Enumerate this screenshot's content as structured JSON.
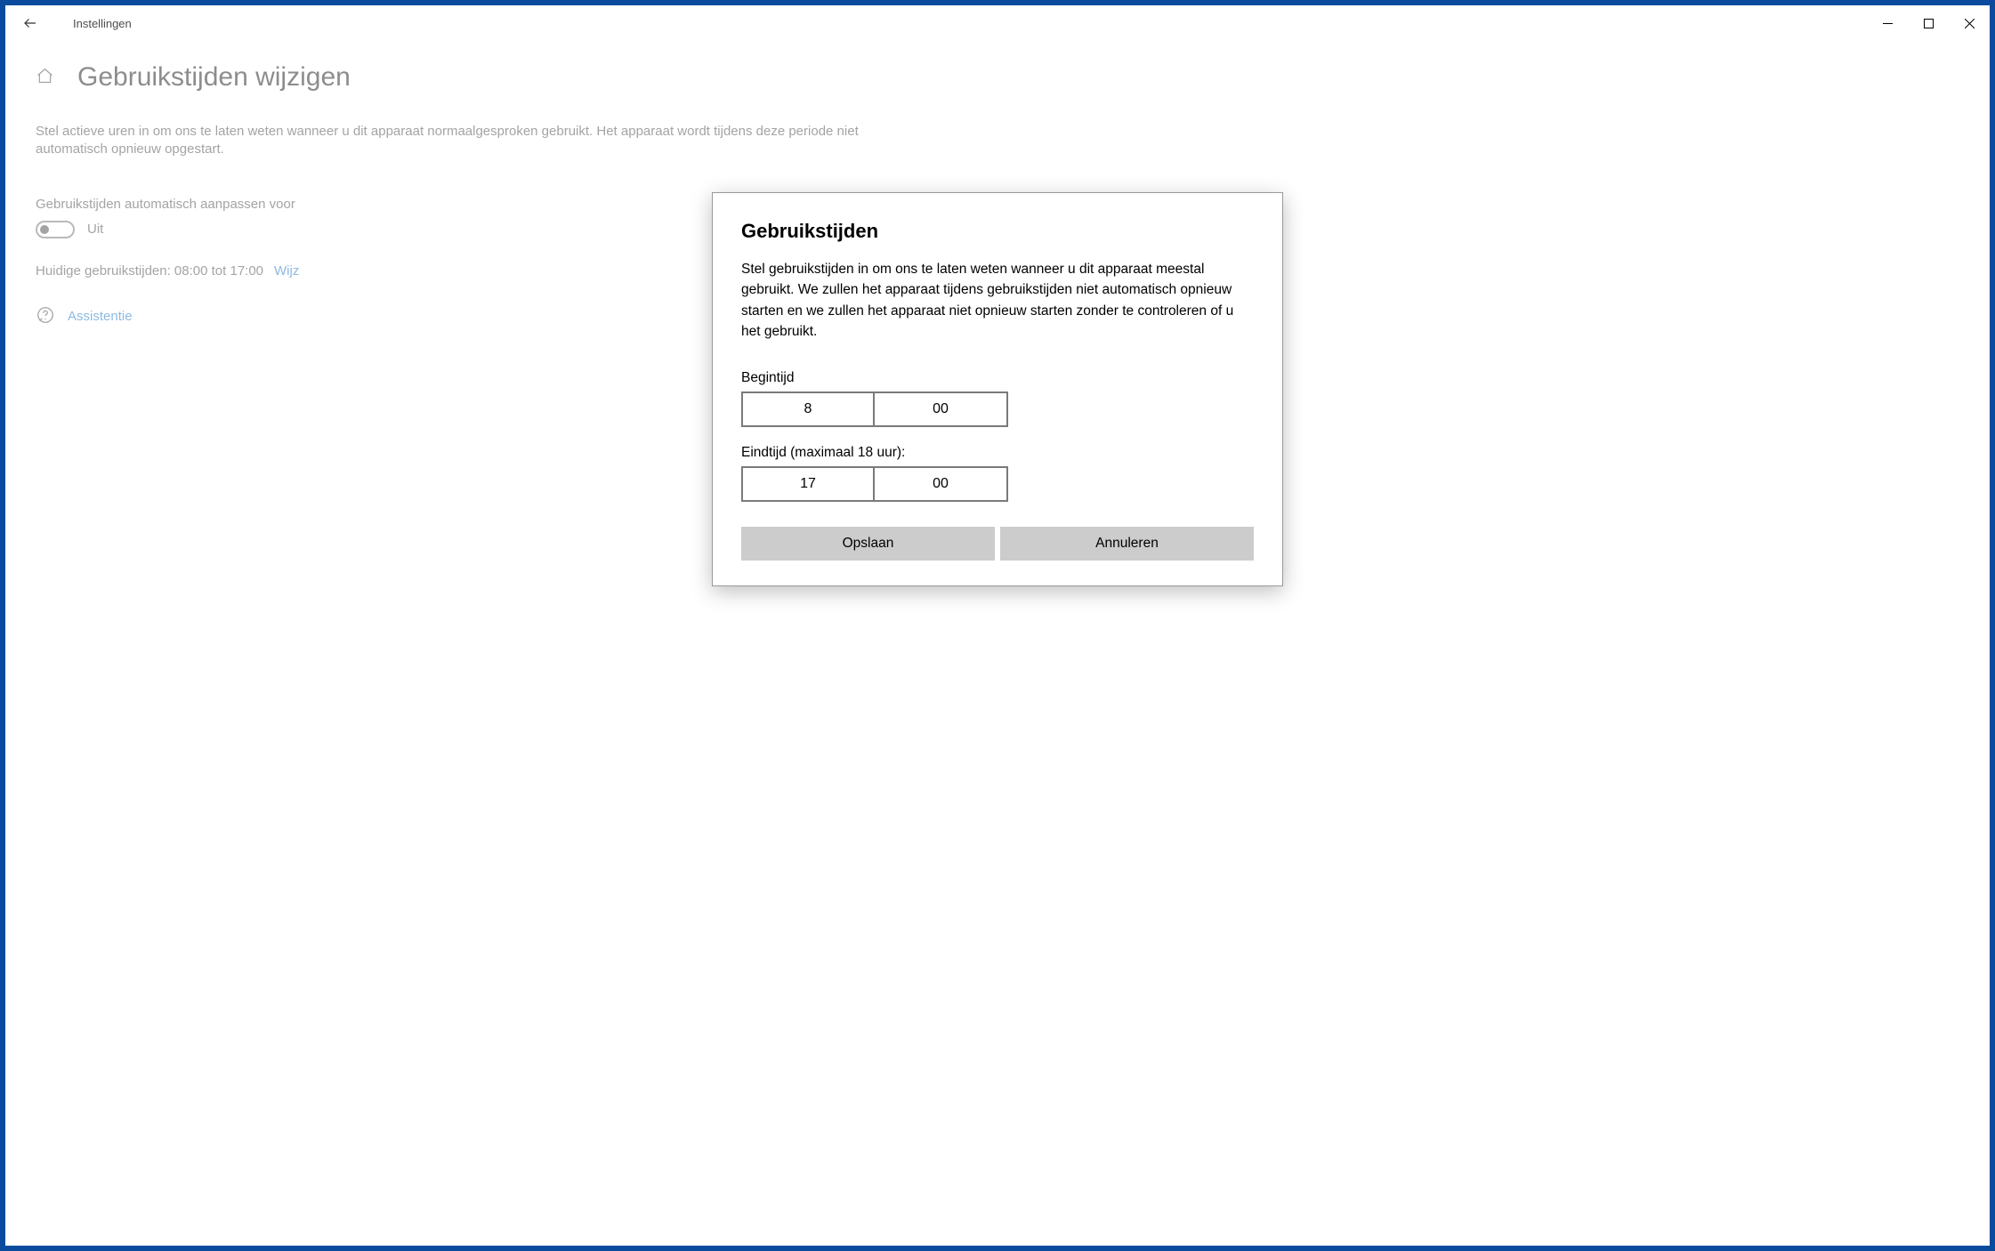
{
  "titlebar": {
    "app_name": "Instellingen"
  },
  "page": {
    "title": "Gebruikstijden wijzigen",
    "description": "Stel actieve uren in om ons te laten weten wanneer u dit apparaat normaalgesproken gebruikt. Het apparaat wordt tijdens deze periode niet automatisch opnieuw opgestart.",
    "auto_adjust_label": "Gebruikstijden automatisch aanpassen voor",
    "toggle_state": "Uit",
    "current_hours_text": "Huidige gebruikstijden: 08:00 tot 17:00",
    "change_link": "Wijz",
    "assistance_link": "Assistentie"
  },
  "dialog": {
    "title": "Gebruikstijden",
    "description": "Stel gebruikstijden in om ons te laten weten wanneer u dit apparaat meestal gebruikt. We zullen het apparaat tijdens gebruikstijden niet automatisch opnieuw starten en we zullen het apparaat niet opnieuw starten zonder te controleren of u het gebruikt.",
    "start_label": "Begintijd",
    "start_hour": "8",
    "start_minute": "00",
    "end_label": "Eindtijd (maximaal 18 uur):",
    "end_hour": "17",
    "end_minute": "00",
    "save_label": "Opslaan",
    "cancel_label": "Annuleren"
  }
}
